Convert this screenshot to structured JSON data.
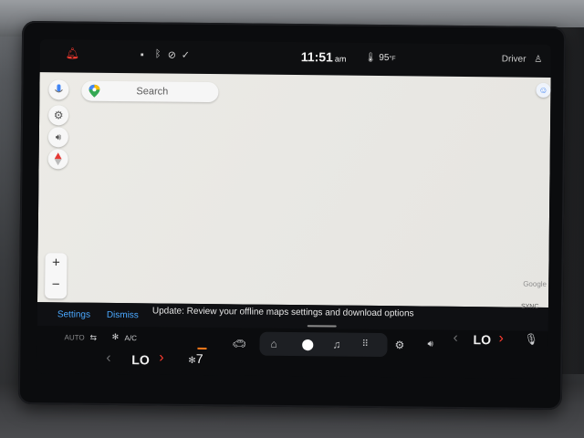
{
  "status_bar": {
    "time": "11:51",
    "ampm": "am",
    "temperature": "95",
    "temperature_unit": "°F",
    "profile": "Driver",
    "icons": [
      "notification-bell-icon",
      "message-icon",
      "bluetooth-icon",
      "wifi-off-icon",
      "check-circle-icon",
      "thermometer-icon",
      "person-icon"
    ]
  },
  "map": {
    "search_placeholder": "Search",
    "attribution": "Google",
    "side_buttons": [
      "microphone-icon",
      "settings-icon",
      "volume-icon",
      "compass-icon"
    ],
    "zoom_in": "+",
    "zoom_out": "−"
  },
  "notification": {
    "settings_link": "Settings",
    "dismiss_link": "Dismiss",
    "message": "Update: Review your offline maps settings and download options",
    "sync_label": "SYNC"
  },
  "climate": {
    "auto": "AUTO",
    "ac": "A/C",
    "left_temp": "LO",
    "right_temp": "LO",
    "fan_speed": "7"
  },
  "nav": {
    "items": [
      "car-icon",
      "home-icon",
      "maps-pin-icon",
      "music-icon",
      "apps-grid-icon",
      "gear-icon",
      "volume-icon",
      "microphone-icon"
    ]
  },
  "colors": {
    "accent_blue": "#4aa8ff",
    "arrow_red": "#ff3b30",
    "map_bg": "#ecebe6"
  }
}
